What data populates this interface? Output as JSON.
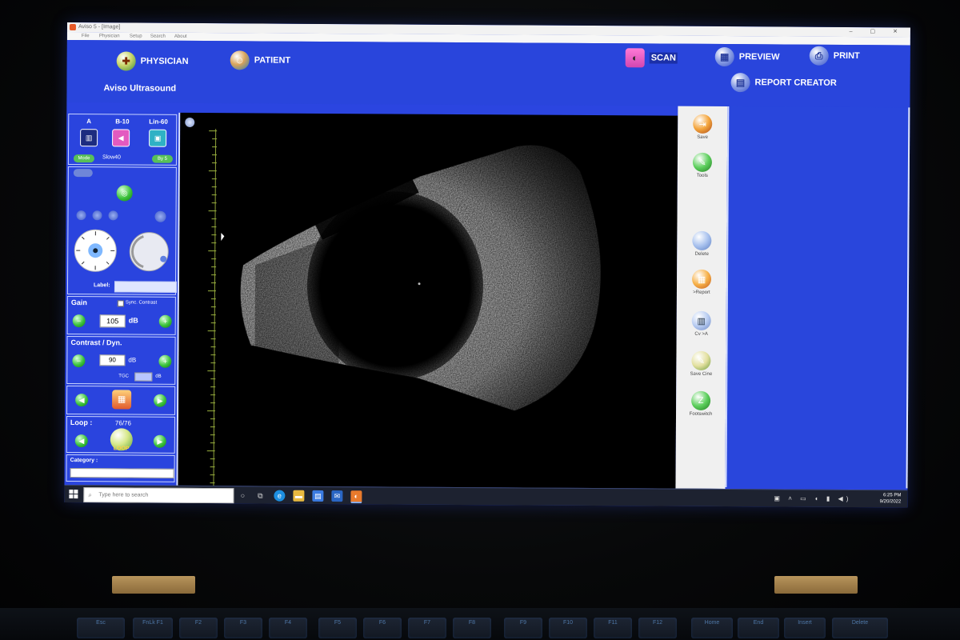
{
  "window": {
    "title": "Aviso 5 - [Image]"
  },
  "menu": {
    "items": [
      "File",
      "Physician",
      "Setup",
      "Search",
      "About"
    ]
  },
  "header": {
    "physician_label": "PHYSICIAN",
    "patient_label": "PATIENT",
    "brand": "Aviso Ultrasound",
    "scan_label": "SCAN",
    "preview_label": "PREVIEW",
    "print_label": "PRINT",
    "report_creator_label": "REPORT CREATOR"
  },
  "probe": {
    "mode_a": "A",
    "mode_b": "B-10",
    "mode_lin": "Lin-60",
    "mode_button": "Mode",
    "speed": "Slow40",
    "by_button": "By 5",
    "label_text": "Label:"
  },
  "gain": {
    "title": "Gain",
    "sync_label": "Sync. Contrast",
    "value": "105",
    "unit": "dB"
  },
  "contrast": {
    "title": "Contrast / Dyn.",
    "value": "90",
    "unit": "dB",
    "tgc_label": "TGC",
    "tgc_unit": "dB"
  },
  "loop": {
    "title": "Loop :",
    "count": "76/76",
    "loop_label": "LOOP"
  },
  "category": {
    "title": "Category :"
  },
  "tools": {
    "save": "Save",
    "tools": "Tools",
    "delete": "Delete",
    "report": ">Report",
    "cv_a": "Cv >A",
    "save_cine": "Save Cine",
    "footswitch": "Footswitch"
  },
  "taskbar": {
    "search_placeholder": "Type here to search",
    "time": "6:25 PM",
    "date": "9/20/2022"
  },
  "keyboard": {
    "keys": [
      "Esc",
      "FnLk F1",
      "F2",
      "F3",
      "F4",
      "F5",
      "F6",
      "F7",
      "F8",
      "F9",
      "F10",
      "F11",
      "F12",
      "Home",
      "End",
      "Insert",
      "Delete"
    ]
  },
  "colors": {
    "app_blue": "#2945dc",
    "accent_green": "#3bc23b",
    "scan_pink": "#e35ac0"
  }
}
